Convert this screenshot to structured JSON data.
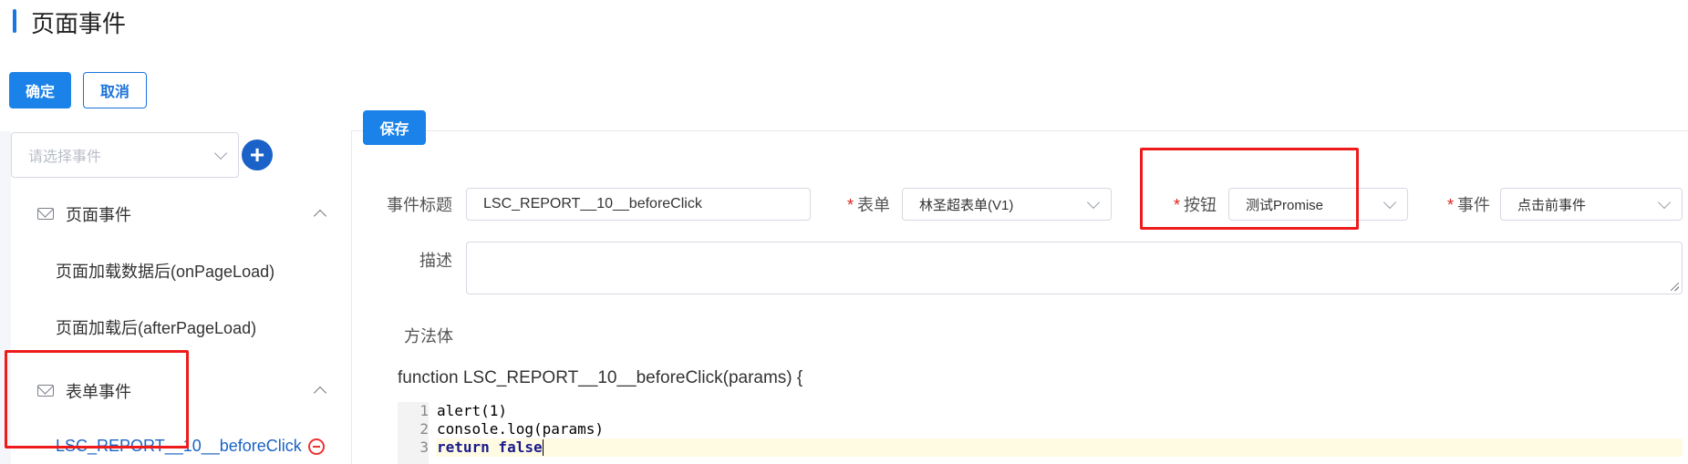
{
  "header": {
    "title": "页面事件"
  },
  "toolbar": {
    "confirm_label": "确定",
    "cancel_label": "取消",
    "save_label": "保存"
  },
  "sidebar": {
    "event_select_placeholder": "请选择事件",
    "add_icon": "plus-icon",
    "groups": [
      {
        "label": "页面事件",
        "icon": "mail-icon",
        "expanded": true,
        "items": [
          {
            "label": "页面加载数据后(onPageLoad)"
          },
          {
            "label": "页面加载后(afterPageLoad)"
          }
        ]
      },
      {
        "label": "表单事件",
        "icon": "mail-icon",
        "expanded": true,
        "items": [
          {
            "label": "LSC_REPORT__10__beforeClick",
            "active": true
          }
        ]
      }
    ]
  },
  "form": {
    "event_title_label": "事件标题",
    "event_title_value": "LSC_REPORT__10__beforeClick",
    "form_label": "表单",
    "form_value": "林圣超表单(V1)",
    "button_label": "按钮",
    "button_value": "测试Promise",
    "event_label": "事件",
    "event_value": "点击前事件",
    "required_mark": "*",
    "description_label": "描述",
    "description_value": "",
    "method_body_label": "方法体",
    "function_signature": "function LSC_REPORT__10__beforeClick(params) {"
  },
  "code_editor": {
    "lines": [
      {
        "no": "1",
        "text": "alert(1)"
      },
      {
        "no": "2",
        "text": "console.log(params)"
      },
      {
        "no": "3",
        "text": "return false"
      }
    ]
  },
  "colors": {
    "primary": "#1a82e8",
    "highlight_box": "#ee1b1b",
    "active_item": "#1a63c4"
  }
}
